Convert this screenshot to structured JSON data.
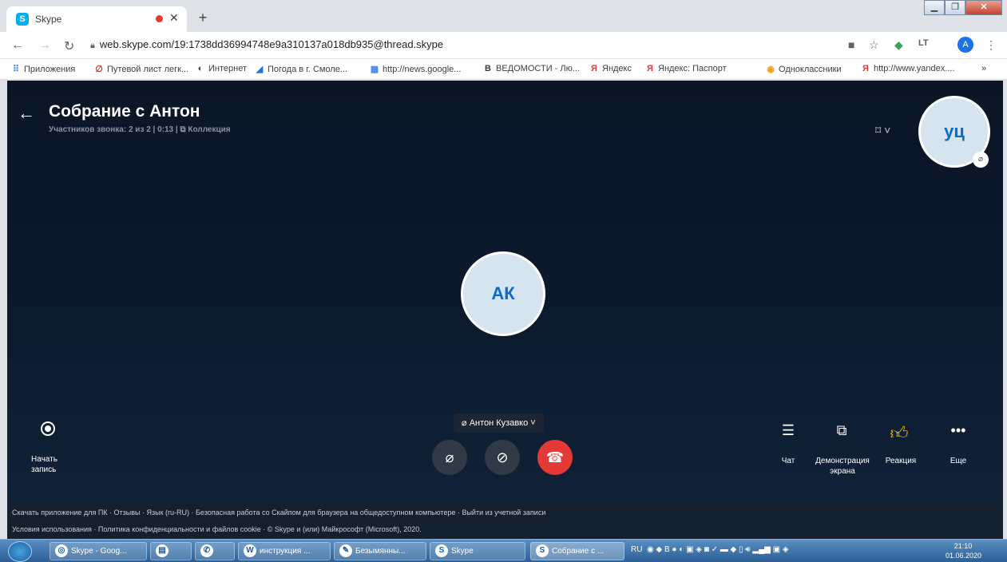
{
  "browser": {
    "tab_title": "Skype",
    "tab_favicon": "S",
    "url": "web.skype.com/19:1738dd36994748e9a310137a018db935@thread.skype",
    "profile_initial": "A",
    "bookmarks": [
      {
        "label": "Приложения",
        "icon": "apps-icon"
      },
      {
        "label": "Путевой лист легк...",
        "icon": "leaf-icon"
      },
      {
        "label": "Интернет",
        "icon": "globe-icon"
      },
      {
        "label": "Погода в г. Смоле...",
        "icon": "weather-icon"
      },
      {
        "label": "http://news.google...",
        "icon": "news-icon"
      },
      {
        "label": "ВЕДОМОСТИ - Лю...",
        "icon": "b-icon"
      },
      {
        "label": "Яндекс",
        "icon": "yandex-icon"
      },
      {
        "label": "Яндекс: Паспорт",
        "icon": "yandex-passport-icon"
      },
      {
        "label": "Одноклассники",
        "icon": "ok-icon"
      },
      {
        "label": "http://www.yandex....",
        "icon": "yandex-icon"
      }
    ],
    "more_bookmarks": "»"
  },
  "call": {
    "title": "Собрание с Антон",
    "subtitle": "Участников звонка: 2 из 2 | 0:13 | ⧉ Коллекция",
    "self_initials": "уц",
    "peer_initials": "АК",
    "speaker": "Антон Кузавко",
    "record_label": "Начать запись",
    "right_controls": [
      {
        "label": "Чат",
        "icon": "chat-icon"
      },
      {
        "label": "Демонстрация экрана",
        "icon": "screen-share-icon"
      },
      {
        "label": "Реакция",
        "icon": "thumbs-up-icon"
      },
      {
        "label": "Еще",
        "icon": "more-icon"
      }
    ]
  },
  "footer": {
    "line1": "Скачать приложение для ПК  ·  Отзывы  ·  Язык (ru-RU)  ·  Безопасная работа со Скайпом для браузера на общедоступном компьютере  ·  Выйти из учетной записи",
    "line2": "Условия использования  ·  Политика конфиденциальности и файлов cookie  ·  © Skype и (или) Майкрософт (Microsoft), 2020."
  },
  "taskbar": {
    "items": [
      {
        "label": "Skype - Goog...",
        "icon": "chrome-icon"
      },
      {
        "label": "",
        "icon": "folder-icon"
      },
      {
        "label": "",
        "icon": "viber-icon"
      },
      {
        "label": "инструкция ...",
        "icon": "word-icon"
      },
      {
        "label": "Безымянны...",
        "icon": "paint-icon"
      },
      {
        "label": "Skype",
        "icon": "skype-icon"
      },
      {
        "label": "Собрание с ...",
        "icon": "skype-icon"
      }
    ],
    "lang": "RU",
    "time": "21:10",
    "date": "01.06.2020"
  },
  "colors": {
    "end_call": "#e53935",
    "avatar_text": "#0f69c6",
    "stage_bg": "#0c1a2e"
  }
}
